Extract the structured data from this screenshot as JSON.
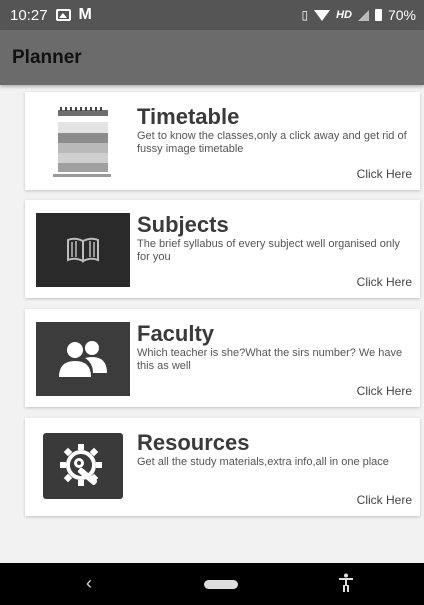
{
  "status_bar": {
    "time": "10:27",
    "m_icon": "M",
    "hd": "HD",
    "battery": "70%"
  },
  "app_bar": {
    "title": "Planner"
  },
  "cards": [
    {
      "title": "Timetable",
      "description": "Get to know the classes,only a click away and get rid of fussy image timetable",
      "link": "Click Here",
      "icon": "timetable-icon"
    },
    {
      "title": "Subjects",
      "description": "The brief syllabus of every subject well organised only for you",
      "link": "Click Here",
      "icon": "book-icon"
    },
    {
      "title": "Faculty",
      "description": "Which teacher is she?What the sirs number? We have this as well",
      "link": "Click Here",
      "icon": "people-icon"
    },
    {
      "title": "Resources",
      "description": "Get all the study materials,extra info,all in one place",
      "link": "Click Here",
      "icon": "gear-wrench-icon"
    }
  ],
  "nav_bar": {
    "back": "‹"
  },
  "colors": {
    "status_bar": "#555555",
    "app_bar": "#6b6b6b",
    "background": "#f2f2f2",
    "card": "#ffffff",
    "nav_bar": "#000000"
  }
}
